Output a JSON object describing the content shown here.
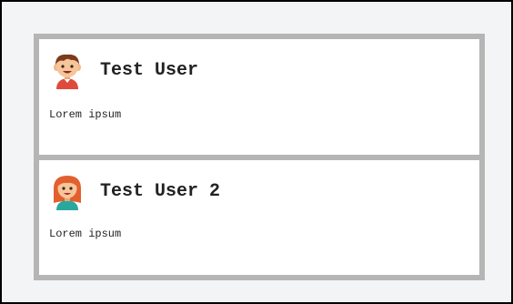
{
  "users": [
    {
      "name": "Test User",
      "bio": "Lorem ipsum",
      "avatar_icon": "boy-avatar-icon"
    },
    {
      "name": "Test User 2",
      "bio": "Lorem ipsum",
      "avatar_icon": "girl-avatar-icon"
    }
  ],
  "colors": {
    "page_background": "#f3f4f6",
    "list_border": "#b5b5b5",
    "card_background": "#ffffff",
    "text": "#222222"
  }
}
